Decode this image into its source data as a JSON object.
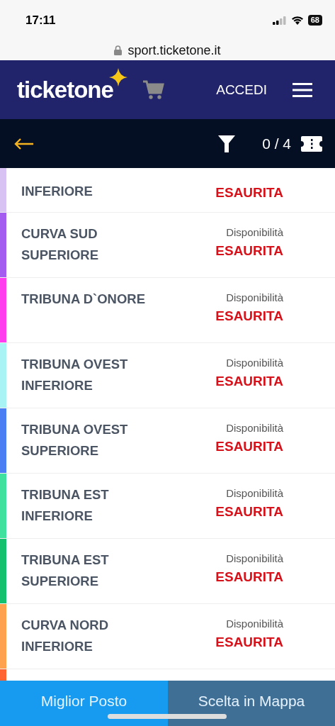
{
  "status_bar": {
    "time": "17:11",
    "battery": "68"
  },
  "url_bar": {
    "address": "sport.ticketone.it"
  },
  "header": {
    "logo": "ticketone",
    "login": "ACCEDI"
  },
  "toolbar": {
    "ticket_count": "0 / 4"
  },
  "sectors": [
    {
      "name": "INFERIORE",
      "color": "#d8c2f4",
      "availability": "ESAURITA"
    },
    {
      "name": "CURVA SUD SUPERIORE",
      "color": "#a45cf0",
      "availability_label": "Disponibilità",
      "availability": "ESAURITA"
    },
    {
      "name": "TRIBUNA D`ONORE",
      "color": "#ff3cee",
      "availability_label": "Disponibilità",
      "availability": "ESAURITA"
    },
    {
      "name": "TRIBUNA OVEST INFERIORE",
      "color": "#a8f4f4",
      "availability_label": "Disponibilità",
      "availability": "ESAURITA"
    },
    {
      "name": "TRIBUNA OVEST SUPERIORE",
      "color": "#4a7ff4",
      "availability_label": "Disponibilità",
      "availability": "ESAURITA"
    },
    {
      "name": "TRIBUNA EST INFERIORE",
      "color": "#3ee29e",
      "availability_label": "Disponibilità",
      "availability": "ESAURITA"
    },
    {
      "name": "TRIBUNA EST SUPERIORE",
      "color": "#12c06e",
      "availability_label": "Disponibilità",
      "availability": "ESAURITA"
    },
    {
      "name": "CURVA NORD INFERIORE",
      "color": "#ffa24e",
      "availability_label": "Disponibilità",
      "availability": "ESAURITA"
    },
    {
      "color": "#ff6530"
    }
  ],
  "bottom_tabs": [
    {
      "label": "Miglior Posto",
      "selected": true
    },
    {
      "label": "Scelta in Mappa",
      "selected": false
    }
  ]
}
